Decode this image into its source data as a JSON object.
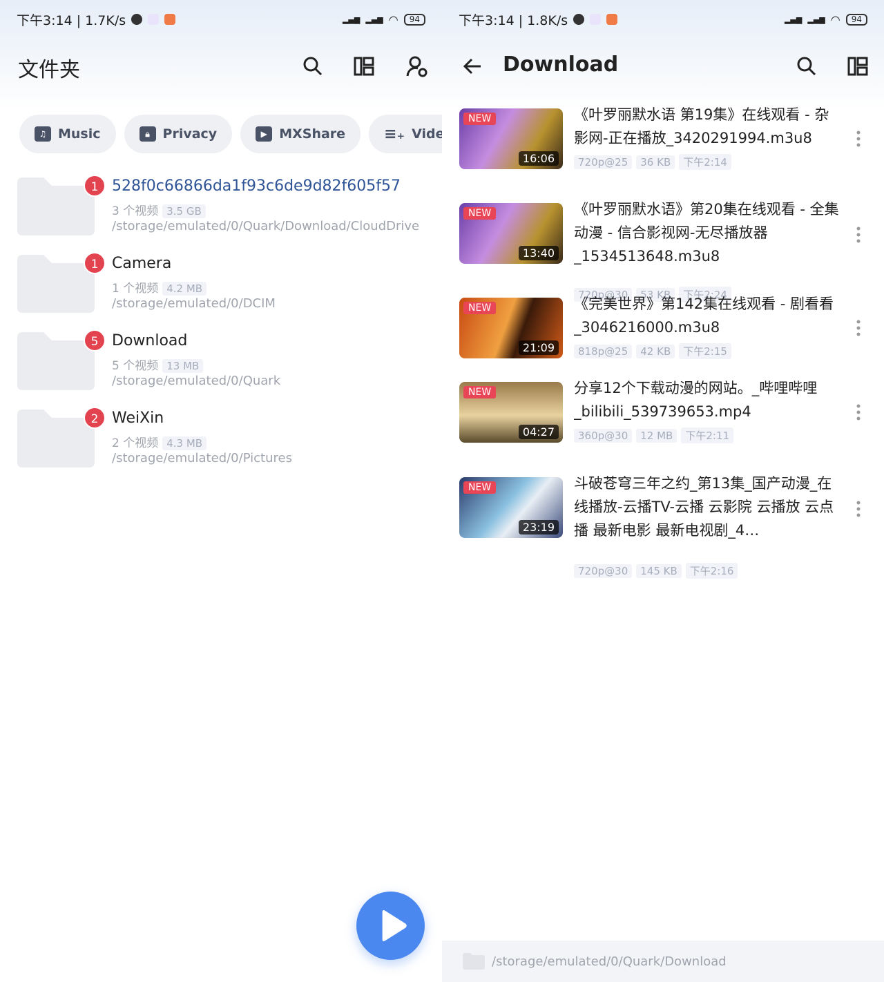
{
  "left": {
    "status": {
      "time": "下午3:14 | 1.7K/s",
      "battery": "94",
      "signal": "HD"
    },
    "title": "文件夹",
    "chips": [
      {
        "label": "Music",
        "icon": "music-folder-icon"
      },
      {
        "label": "Privacy",
        "icon": "lock-folder-icon"
      },
      {
        "label": "MXShare",
        "icon": "share-icon"
      },
      {
        "label": "Video l",
        "icon": "playlist-add-icon"
      }
    ],
    "folders": [
      {
        "badge": "1",
        "name": "528f0c66866da1f93c6de9d82f605f57",
        "count": "3 个视频",
        "size": "3.5 GB",
        "path": "/storage/emulated/0/Quark/Download/CloudDrive",
        "highlight": true
      },
      {
        "badge": "1",
        "name": "Camera",
        "count": "1 个视频",
        "size": "4.2 MB",
        "path": "/storage/emulated/0/DCIM"
      },
      {
        "badge": "5",
        "name": "Download",
        "count": "5 个视频",
        "size": "13 MB",
        "path": "/storage/emulated/0/Quark"
      },
      {
        "badge": "2",
        "name": "WeiXin",
        "count": "2 个视频",
        "size": "4.3 MB",
        "path": "/storage/emulated/0/Pictures"
      }
    ]
  },
  "right": {
    "status": {
      "time": "下午3:14 | 1.8K/s",
      "battery": "94",
      "signal": "HD"
    },
    "title": "Download",
    "videos": [
      {
        "new": "NEW",
        "duration": "16:06",
        "title": "《叶罗丽默水语 第19集》在线观看 - 杂影网-正在播放_3420291994.m3u8",
        "res": "720p@25",
        "size": "36 KB",
        "time": "下午2:14"
      },
      {
        "new": "NEW",
        "duration": "13:40",
        "title": "《叶罗丽默水语》第20集在线观看 - 全集动漫 - 信合影视网-无尽播放器_1534513648.m3u8",
        "res": "720p@30",
        "size": "53 KB",
        "time": "下午2:24"
      },
      {
        "new": "NEW",
        "duration": "21:09",
        "title": "《完美世界》第142集在线观看 - 剧看看_3046216000.m3u8",
        "res": "818p@25",
        "size": "42 KB",
        "time": "下午2:15"
      },
      {
        "new": "NEW",
        "duration": "04:27",
        "title": "分享12个下载动漫的网站。_哔哩哔哩_bilibili_539739653.mp4",
        "res": "360p@30",
        "size": "12 MB",
        "time": "下午2:11"
      },
      {
        "new": "NEW",
        "duration": "23:19",
        "title": "斗破苍穹三年之约_第13集_国产动漫_在线播放-云播TV-云播 云影院 云播放 云点播 最新电影 最新电视剧_4…",
        "res": "720p@30",
        "size": "145 KB",
        "time": "下午2:16"
      }
    ],
    "bottom_path": "/storage/emulated/0/Quark/Download"
  },
  "colors": {
    "accent": "#4a88ef",
    "badge": "#e3434f",
    "link": "#2f5597"
  }
}
